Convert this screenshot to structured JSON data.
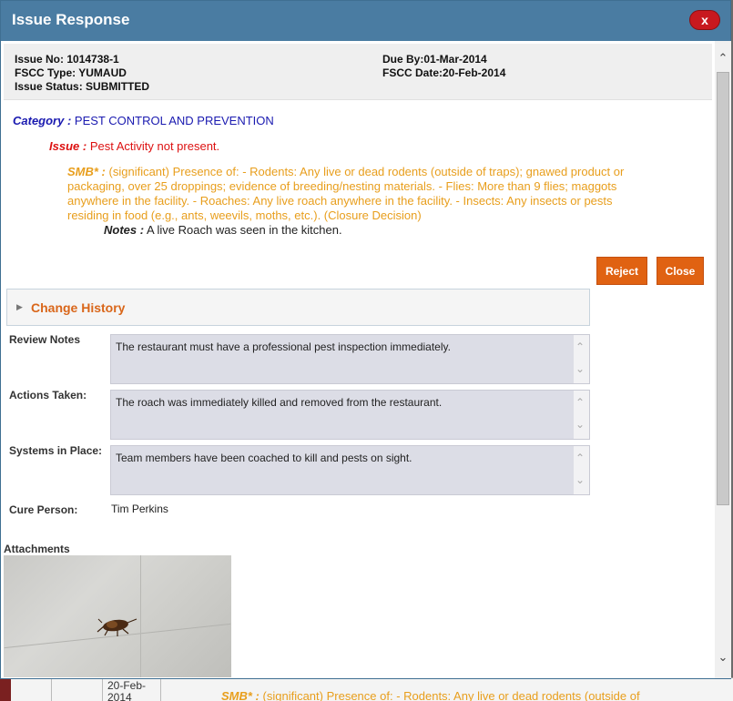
{
  "dialog": {
    "title": "Issue Response",
    "close_label": "x"
  },
  "info": {
    "issue_no": "Issue No: 1014738-1",
    "fscc_type": "FSCC Type: YUMAUD",
    "issue_status": "Issue Status: SUBMITTED",
    "due_by": "Due By:01-Mar-2014",
    "fscc_date": "FSCC Date:20-Feb-2014"
  },
  "category": {
    "label": "Category :",
    "value": "PEST CONTROL AND PREVENTION"
  },
  "issue": {
    "label": "Issue :",
    "value": "Pest Activity not present."
  },
  "smb": {
    "label": "SMB* :",
    "value": "(significant) Presence of: - Rodents: Any live or dead rodents (outside of traps); gnawed product or packaging, over 25 droppings; evidence of breeding/nesting materials. - Flies: More than 9 flies; maggots anywhere in the facility. - Roaches: Any live roach anywhere in the facility. - Insects: Any insects or pests residing in food (e.g., ants, weevils, moths, etc.). (Closure Decision)"
  },
  "notes": {
    "label": "Notes :",
    "value": "A live Roach was seen in the kitchen."
  },
  "buttons": {
    "reject": "Reject",
    "close": "Close"
  },
  "change_history": {
    "title": "Change History"
  },
  "fields": {
    "review_notes": {
      "label": "Review Notes",
      "value": "The restaurant must have a professional pest inspection immediately."
    },
    "actions_taken": {
      "label": "Actions Taken:",
      "value": "The roach was immediately killed and removed from the restaurant."
    },
    "systems_in_place": {
      "label": "Systems in Place:",
      "value": "Team members have been coached to kill and pests on sight."
    }
  },
  "cure_person": {
    "label": "Cure Person:",
    "value": "Tim Perkins"
  },
  "attachments": {
    "label": "Attachments"
  },
  "background": {
    "date": "20-Feb-2014",
    "smb_label": "SMB* :",
    "smb_text": "(significant) Presence of: - Rodents: Any live or dead rodents (outside of"
  },
  "colors": {
    "titlebar": "#4a7ca2",
    "button": "#e06212",
    "category": "#1a1ab0",
    "issue": "#dd1111",
    "smb": "#e89e1c"
  }
}
